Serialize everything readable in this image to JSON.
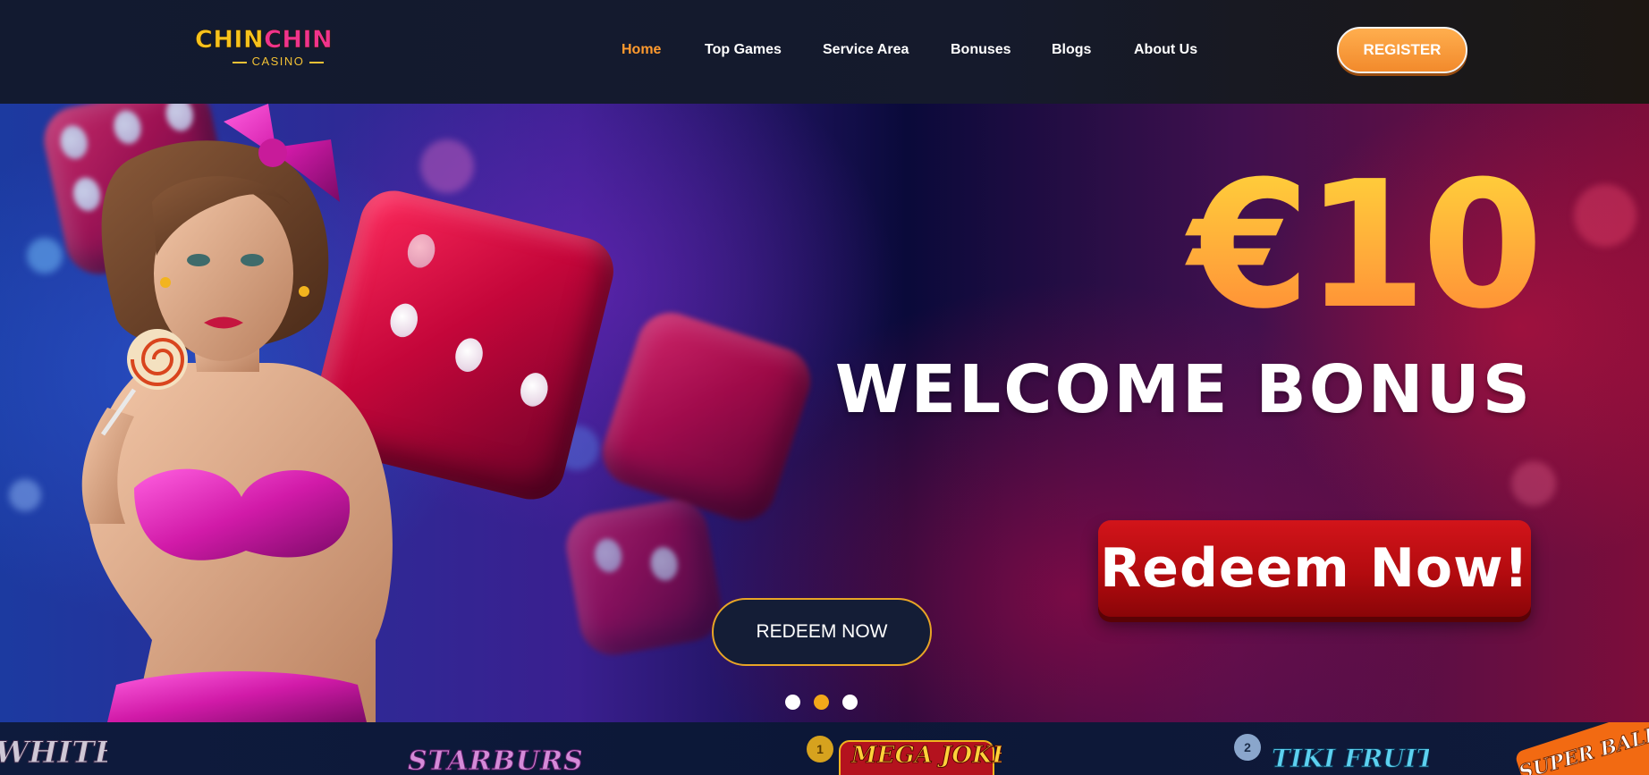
{
  "brand": {
    "logo_word1": "CHIN",
    "logo_word2": "CHIN",
    "logo_sub": "CASINO",
    "colors": {
      "yellow": "#f7c21c",
      "pink": "#f0338d",
      "orange": "#ff9a2e"
    }
  },
  "nav": {
    "items": [
      {
        "label": "Home",
        "active": true
      },
      {
        "label": "Top Games",
        "active": false
      },
      {
        "label": "Service Area",
        "active": false
      },
      {
        "label": "Bonuses",
        "active": false
      },
      {
        "label": "Blogs",
        "active": false
      },
      {
        "label": "About Us",
        "active": false
      }
    ],
    "register_label": "REGISTER"
  },
  "hero": {
    "amount": "€10",
    "title": "WELCOME BONUS",
    "banner_label": "Redeem Now!",
    "cta_label": "REDEEM NOW",
    "slides": {
      "count": 3,
      "active_index": 2
    }
  },
  "games_strip": {
    "items": [
      {
        "name": "White Rabbit",
        "visible_text": "WHITE RABBIT"
      },
      {
        "name": "Starburst",
        "visible_text": "STARBURST"
      },
      {
        "name": "Mega Joker",
        "visible_text": "MEGA JOKER",
        "rank": "1"
      },
      {
        "name": "Tiki Fruit",
        "visible_text": "TIKI FRUIT",
        "rank": "2"
      },
      {
        "name": "Super Ball",
        "visible_text": "SUPER BALL"
      }
    ]
  }
}
